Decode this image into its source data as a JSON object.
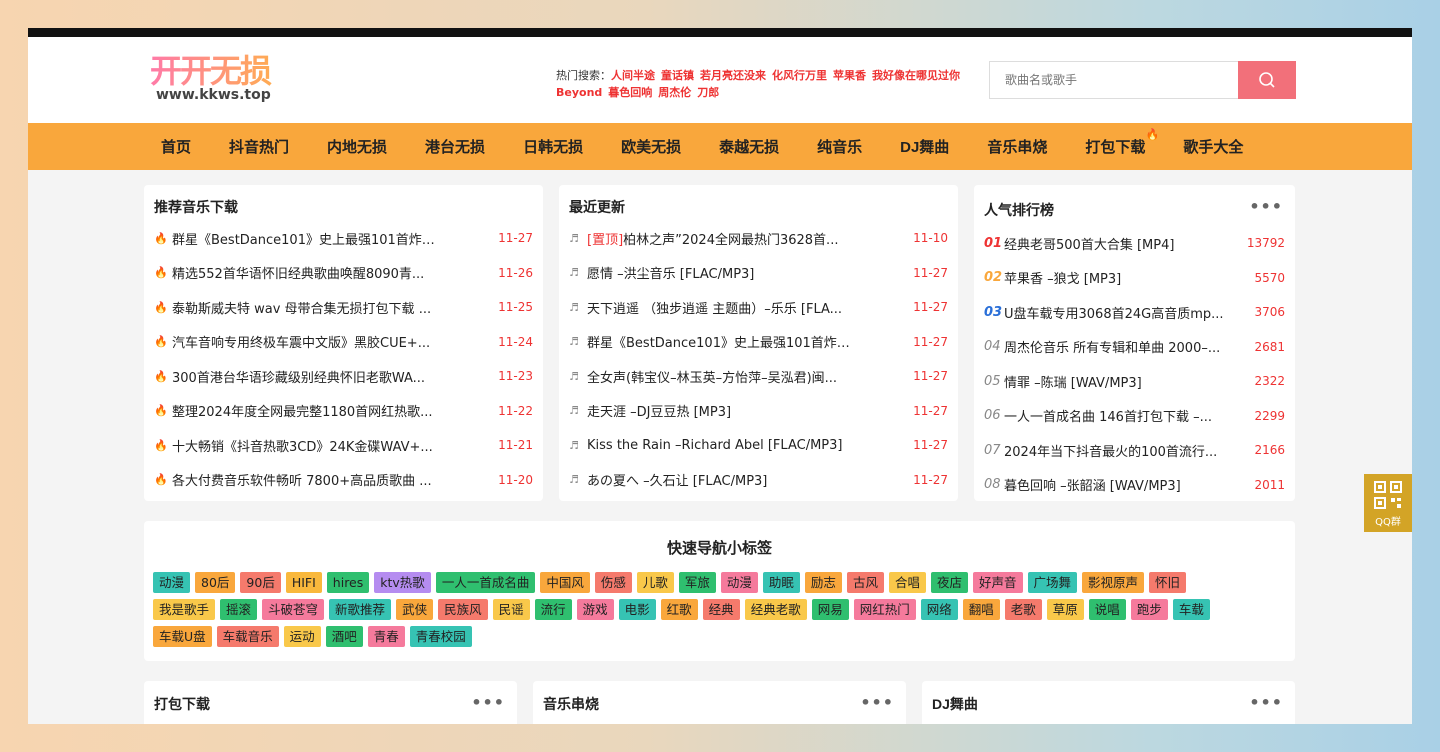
{
  "logo": {
    "cn": "开开无损",
    "url": "www.kkws.top"
  },
  "hot": {
    "label": "热门搜索：",
    "items": [
      "人间半途",
      "童话镇",
      "若月亮还没来",
      "化风行万里",
      "苹果香",
      "我好像在哪见过你",
      "Beyond",
      "暮色回响",
      "周杰伦",
      "刀郎"
    ]
  },
  "search": {
    "placeholder": "歌曲名或歌手"
  },
  "nav": [
    {
      "label": "首页"
    },
    {
      "label": "抖音热门"
    },
    {
      "label": "内地无损"
    },
    {
      "label": "港台无损"
    },
    {
      "label": "日韩无损"
    },
    {
      "label": "欧美无损"
    },
    {
      "label": "泰越无损"
    },
    {
      "label": "纯音乐"
    },
    {
      "label": "DJ舞曲"
    },
    {
      "label": "音乐串烧"
    },
    {
      "label": "打包下载",
      "hot": true
    },
    {
      "label": "歌手大全"
    }
  ],
  "recommend": {
    "title": "推荐音乐下载",
    "items": [
      {
        "t": "群星《BestDance101》史上最强101首炸机...",
        "d": "11-27"
      },
      {
        "t": "精选552首华语怀旧经典歌曲唤醒8090青...",
        "d": "11-26"
      },
      {
        "t": "泰勒斯威夫特 wav 母带合集无损打包下载 ...",
        "d": "11-25"
      },
      {
        "t": "汽车音响专用终极车震中文版》黑胶CUE+...",
        "d": "11-24"
      },
      {
        "t": "300首港台华语珍藏级别经典怀旧老歌WA...",
        "d": "11-23"
      },
      {
        "t": "整理2024年度全网最完整1180首网红热歌...",
        "d": "11-22"
      },
      {
        "t": "十大畅销《抖音热歌3CD》24K金碟WAV+...",
        "d": "11-21"
      },
      {
        "t": "各大付费音乐软件畅听 7800+高品质歌曲 ...",
        "d": "11-20"
      }
    ]
  },
  "latest": {
    "title": "最近更新",
    "items": [
      {
        "tag": "[置顶]",
        "t": "柏林之声”2024全网最热门3628首...",
        "d": "11-10"
      },
      {
        "t": "愿情 –洪尘音乐 [FLAC/MP3]",
        "d": "11-27"
      },
      {
        "t": "天下逍遥 （独步逍遥 主题曲）–乐乐 [FLA...",
        "d": "11-27"
      },
      {
        "t": "群星《BestDance101》史上最强101首炸机...",
        "d": "11-27"
      },
      {
        "t": "全女声(韩宝仪–林玉英–方怡萍–吴泓君)闽...",
        "d": "11-27"
      },
      {
        "t": "走天涯 –DJ豆豆热 [MP3]",
        "d": "11-27"
      },
      {
        "t": "Kiss the Rain –Richard Abel [FLAC/MP3]",
        "d": "11-27"
      },
      {
        "t": "あの夏へ –久石让 [FLAC/MP3]",
        "d": "11-27"
      }
    ]
  },
  "ranking": {
    "title": "人气排行榜",
    "items": [
      {
        "n": "01",
        "t": "经典老哥500首大合集 [MP4]",
        "d": "13792"
      },
      {
        "n": "02",
        "t": "苹果香 –狼戈 [MP3]",
        "d": "5570"
      },
      {
        "n": "03",
        "t": "U盘车载专用3068首24G高音质mp...",
        "d": "3706"
      },
      {
        "n": "04",
        "t": "周杰伦音乐 所有专辑和单曲 2000–...",
        "d": "2681"
      },
      {
        "n": "05",
        "t": "情罪 –陈瑞 [WAV/MP3]",
        "d": "2322"
      },
      {
        "n": "06",
        "t": "一人一首成名曲 146首打包下载 –...",
        "d": "2299"
      },
      {
        "n": "07",
        "t": "2024年当下抖音最火的100首流行...",
        "d": "2166"
      },
      {
        "n": "08",
        "t": "暮色回响 –张韶涵 [WAV/MP3]",
        "d": "2011"
      }
    ]
  },
  "tags": {
    "title": "快速导航小标签",
    "items": [
      [
        "动漫",
        "#36c3b3"
      ],
      [
        "80后",
        "#f9a73c"
      ],
      [
        "90后",
        "#f57a6c"
      ],
      [
        "HIFI",
        "#f9b83c"
      ],
      [
        "hires",
        "#2fbf6f"
      ],
      [
        "ktv热歌",
        "#b58cf0"
      ],
      [
        "一人一首成名曲",
        "#2fbf6f"
      ],
      [
        "中国风",
        "#f9a73c"
      ],
      [
        "伤感",
        "#f57a6c"
      ],
      [
        "儿歌",
        "#f9c84a"
      ],
      [
        "军旅",
        "#2fbf6f"
      ],
      [
        "动漫",
        "#f57a9c"
      ],
      [
        "助眠",
        "#36c3b3"
      ],
      [
        "励志",
        "#f9a73c"
      ],
      [
        "古风",
        "#f57a6c"
      ],
      [
        "合唱",
        "#f9c84a"
      ],
      [
        "夜店",
        "#2fbf6f"
      ],
      [
        "好声音",
        "#f57a9c"
      ],
      [
        "广场舞",
        "#36c3b3"
      ],
      [
        "影视原声",
        "#f9a73c"
      ],
      [
        "怀旧",
        "#f57a6c"
      ],
      [
        "我是歌手",
        "#f9c84a"
      ],
      [
        "摇滚",
        "#2fbf6f"
      ],
      [
        "斗破苍穹",
        "#f57a9c"
      ],
      [
        "新歌推荐",
        "#36c3b3"
      ],
      [
        "武侠",
        "#f9a73c"
      ],
      [
        "民族风",
        "#f57a6c"
      ],
      [
        "民谣",
        "#f9c84a"
      ],
      [
        "流行",
        "#2fbf6f"
      ],
      [
        "游戏",
        "#f57a9c"
      ],
      [
        "电影",
        "#36c3b3"
      ],
      [
        "红歌",
        "#f9a73c"
      ],
      [
        "经典",
        "#f57a6c"
      ],
      [
        "经典老歌",
        "#f9c84a"
      ],
      [
        "网易",
        "#2fbf6f"
      ],
      [
        "网红热门",
        "#f57a9c"
      ],
      [
        "网络",
        "#36c3b3"
      ],
      [
        "翻唱",
        "#f9a73c"
      ],
      [
        "老歌",
        "#f57a6c"
      ],
      [
        "草原",
        "#f9c84a"
      ],
      [
        "说唱",
        "#2fbf6f"
      ],
      [
        "跑步",
        "#f57a9c"
      ],
      [
        "车载",
        "#36c3b3"
      ],
      [
        "车载U盘",
        "#f9a73c"
      ],
      [
        "车载音乐",
        "#f57a6c"
      ],
      [
        "运动",
        "#f9c84a"
      ],
      [
        "酒吧",
        "#2fbf6f"
      ],
      [
        "青春",
        "#f57a9c"
      ],
      [
        "青春校园",
        "#36c3b3"
      ]
    ]
  },
  "bottom": {
    "pack": "打包下载",
    "medley": "音乐串烧",
    "dj": "DJ舞曲"
  },
  "qq": {
    "label": "QQ群"
  }
}
